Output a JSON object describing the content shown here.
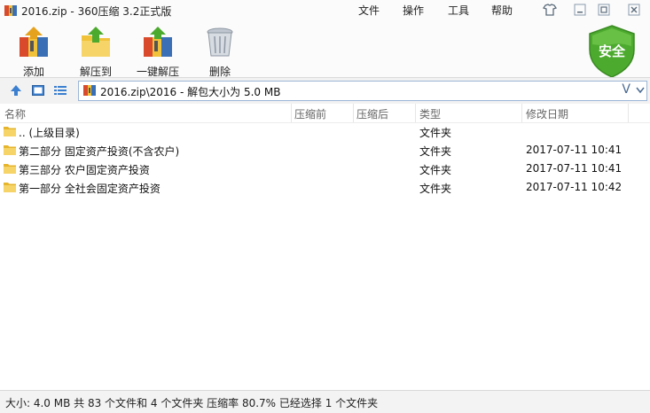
{
  "window": {
    "title": "2016.zip - 360压缩 3.2正式版",
    "menu": [
      "文件",
      "操作",
      "工具",
      "帮助"
    ]
  },
  "toolbar": {
    "add": "添加",
    "extract_to": "解压到",
    "one_click_extract": "一键解压",
    "delete": "删除",
    "security_badge": "安全"
  },
  "address": {
    "path": "2016.zip\\2016 - 解包大小为 5.0 MB",
    "dropdown_glyph": "V"
  },
  "columns": {
    "name": "名称",
    "compressed": "压缩前",
    "after": "压缩后",
    "type": "类型",
    "modified": "修改日期"
  },
  "files": [
    {
      "name": ".. (上级目录)",
      "type": "文件夹",
      "modified": ""
    },
    {
      "name": "第二部分 固定资产投资(不含农户)",
      "type": "文件夹",
      "modified": "2017-07-11 10:41"
    },
    {
      "name": "第三部分 农户固定资产投资",
      "type": "文件夹",
      "modified": "2017-07-11 10:41"
    },
    {
      "name": "第一部分 全社会固定资产投资",
      "type": "文件夹",
      "modified": "2017-07-11 10:42"
    }
  ],
  "status": "大小: 4.0 MB 共 83 个文件和 4 个文件夹 压缩率 80.7% 已经选择 1 个文件夹",
  "colors": {
    "accent": "#3a7fd0",
    "shield_green": "#4caa2e",
    "folder_yellow": "#f0c23a"
  }
}
